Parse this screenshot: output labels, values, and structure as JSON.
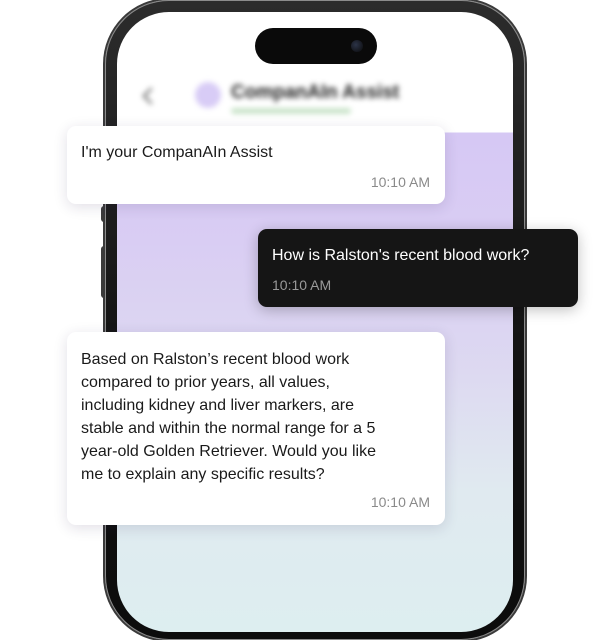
{
  "app": {
    "title": "CompanAIn Assist"
  },
  "icons": {
    "back": "chevron-left-icon",
    "avatar": "assistant-avatar-icon"
  },
  "colors": {
    "chat_background_top": "#d6c8f4",
    "chat_background_bottom": "#ddeef0",
    "user_bubble": "#151515",
    "assistant_bubble": "#ffffff",
    "timestamp": "#8a8a8a"
  },
  "messages": [
    {
      "sender": "assistant",
      "text": "I'm your CompanAIn Assist",
      "time": "10:10 AM"
    },
    {
      "sender": "user",
      "text": "How is Ralston's recent blood work?",
      "time": "10:10 AM"
    },
    {
      "sender": "assistant",
      "text": "Based on Ralston’s recent blood work\ncompared to prior years, all values,\nincluding kidney and liver markers, are\nstable and within the normal range for a  5\nyear-old Golden Retriever. Would you like\nme to explain any specific results?",
      "time": "10:10 AM"
    }
  ]
}
